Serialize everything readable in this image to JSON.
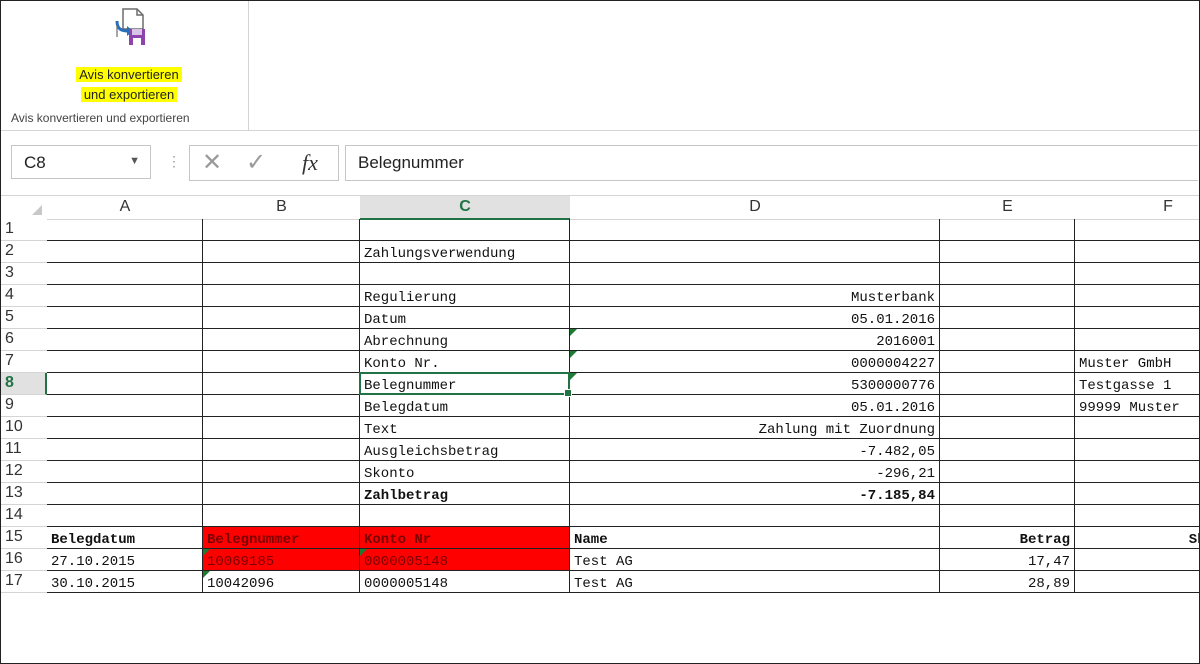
{
  "ribbon": {
    "button_line1": "Avis konvertieren",
    "button_line2": "und exportieren",
    "group_label": "Avis konvertieren und exportieren",
    "icon": "convert-export-icon"
  },
  "formula_bar": {
    "name_box": "C8",
    "content": "Belegnummer",
    "cancel_icon": "✕",
    "enter_icon": "✓",
    "fx_label": "fx"
  },
  "grid": {
    "columns": [
      "A",
      "B",
      "C",
      "D",
      "E",
      "F"
    ],
    "selected_column": "C",
    "selected_row": "8",
    "rows": [
      {
        "num": "1",
        "cells": [
          "",
          "",
          "",
          "",
          "",
          ""
        ]
      },
      {
        "num": "2",
        "cells": [
          "",
          "",
          "Zahlungsverwendung",
          "",
          "",
          ""
        ]
      },
      {
        "num": "3",
        "cells": [
          "",
          "",
          "",
          "",
          "",
          ""
        ]
      },
      {
        "num": "4",
        "cells": [
          "",
          "",
          "Regulierung",
          "Musterbank ",
          "",
          ""
        ]
      },
      {
        "num": "5",
        "cells": [
          "",
          "",
          "Datum",
          "05.01.2016",
          "",
          ""
        ]
      },
      {
        "num": "6",
        "cells": [
          "",
          "",
          "Abrechnung",
          "2016001",
          "",
          ""
        ]
      },
      {
        "num": "7",
        "cells": [
          "",
          "",
          "Konto Nr.",
          "0000004227",
          "",
          "Muster GmbH"
        ]
      },
      {
        "num": "8",
        "cells": [
          "",
          "",
          "Belegnummer",
          "5300000776",
          "",
          "Testgasse 1"
        ]
      },
      {
        "num": "9",
        "cells": [
          "",
          "",
          "Belegdatum",
          "05.01.2016",
          "",
          "99999 Muster"
        ]
      },
      {
        "num": "10",
        "cells": [
          "",
          "",
          "Text",
          "Zahlung mit Zuordnung",
          "",
          ""
        ]
      },
      {
        "num": "11",
        "cells": [
          "",
          "",
          "Ausgleichsbetrag",
          "-7.482,05",
          "",
          ""
        ]
      },
      {
        "num": "12",
        "cells": [
          "",
          "",
          "Skonto",
          "-296,21",
          "",
          ""
        ]
      },
      {
        "num": "13",
        "cells": [
          "",
          "",
          "Zahlbetrag",
          "-7.185,84",
          "",
          ""
        ]
      },
      {
        "num": "14",
        "cells": [
          "",
          "",
          "",
          "",
          "",
          ""
        ]
      },
      {
        "num": "15",
        "cells": [
          "Belegdatum",
          "Belegnummer",
          "Konto Nr",
          "Name",
          "Betrag",
          "Skontobe"
        ]
      },
      {
        "num": "16",
        "cells": [
          "27.10.2015",
          "10069185",
          "0000005148",
          "Test AG",
          "17,47",
          ""
        ]
      },
      {
        "num": "17",
        "cells": [
          "30.10.2015",
          "10042096",
          "0000005148",
          "Test AG",
          "28,89",
          ""
        ]
      }
    ],
    "highlight_color": "#ff0000",
    "selection_color": "#217346"
  }
}
